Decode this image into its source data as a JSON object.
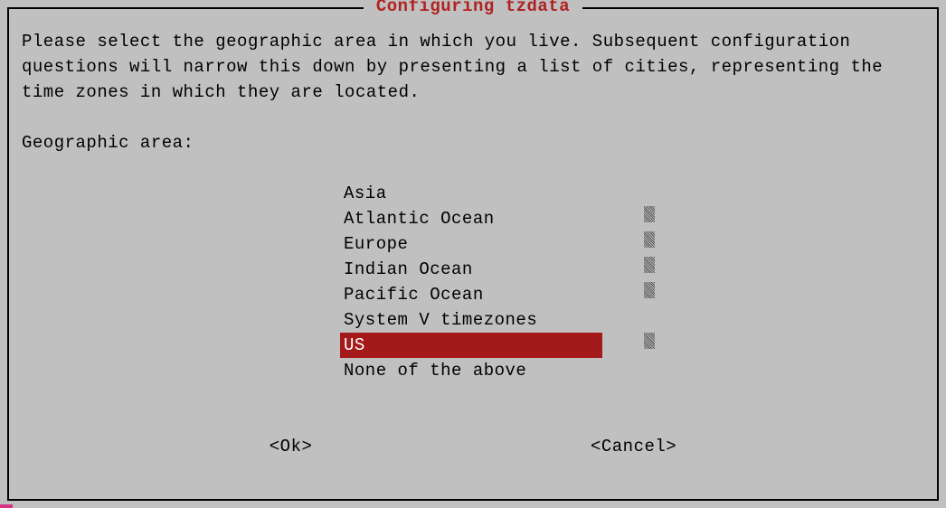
{
  "title": "Configuring tzdata",
  "description": "Please select the geographic area in which you live. Subsequent configuration questions will narrow this down by presenting a list of cities, representing the time zones in which they are located.",
  "prompt": "Geographic area:",
  "list": {
    "items": [
      {
        "label": "Asia",
        "selected": false
      },
      {
        "label": "Atlantic Ocean",
        "selected": false
      },
      {
        "label": "Europe",
        "selected": false
      },
      {
        "label": "Indian Ocean",
        "selected": false
      },
      {
        "label": "Pacific Ocean",
        "selected": false
      },
      {
        "label": "System V timezones",
        "selected": false
      },
      {
        "label": "US",
        "selected": true
      },
      {
        "label": "None of the above",
        "selected": false
      }
    ]
  },
  "buttons": {
    "ok": "<Ok>",
    "cancel": "<Cancel>"
  },
  "colors": {
    "background": "#c0c0c0",
    "title": "#b22222",
    "highlight_bg": "#a41919",
    "highlight_fg": "#ffffff",
    "border": "#000000"
  }
}
